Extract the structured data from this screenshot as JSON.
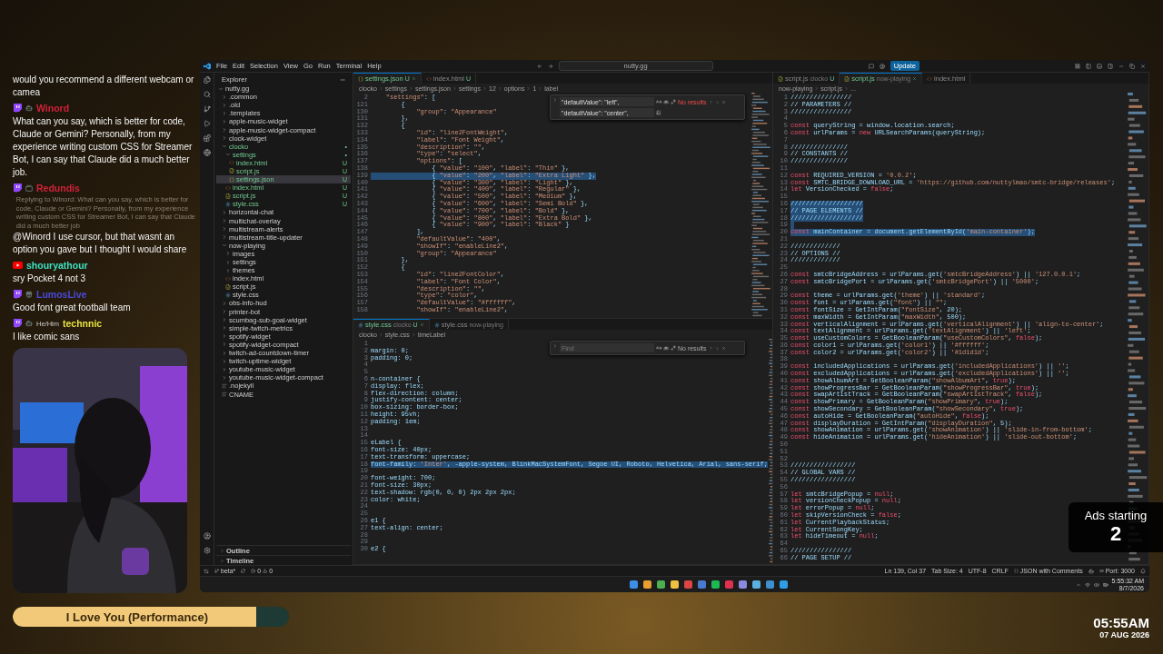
{
  "chat": {
    "messages": [
      {
        "kind": "continued",
        "text": "would you recommend a different webcam or camea"
      },
      {
        "kind": "twitch",
        "user": "Winord",
        "color": "#d0223a",
        "text": "What can you say, which is better for code, Claude or Gemini? Personally, from my experience writing custom CSS for Streamer Bot, I can say that Claude did a much better job."
      },
      {
        "kind": "twitch",
        "user": "Redundis",
        "color": "#d0223a",
        "reply": "Replying to Winord: What can you say, which is better for code, Claude or Gemini? Personally, from my experience writing custom CSS for Streamer Bot, I can say that Claude did a much better job",
        "text": "@Winord I use cursor, but that wasnt an option you gave but I thought I would share"
      },
      {
        "kind": "youtube",
        "user": "shouryathour",
        "color": "#3ee0c0",
        "text": "sry Pocket 4 not 3"
      },
      {
        "kind": "twitch",
        "user": "LumosLive",
        "color": "#4a4ad8",
        "text": "Good font great football team"
      },
      {
        "kind": "twitch",
        "user": "technnic",
        "color": "#e8e040",
        "pronoun": "He/Him",
        "text": "I like comic sans"
      }
    ]
  },
  "now_playing": {
    "title": "I Love You (Performance)",
    "level": 0.88
  },
  "clock": {
    "time": "05:55AM",
    "date": "07 AUG 2026"
  },
  "ads": {
    "label": "Ads starting",
    "count": "2"
  },
  "editor_window": {
    "menu": [
      "File",
      "Edit",
      "Selection",
      "View",
      "Go",
      "Run",
      "Terminal",
      "Help"
    ],
    "search": "nutty.gg",
    "update_button": "Update",
    "explorer": {
      "title": "Explorer",
      "tree": [
        {
          "name": "nutty.gg",
          "kind": "folder",
          "expanded": true,
          "selected": false,
          "children": [
            {
              "name": ".common",
              "kind": "folder",
              "expanded": false,
              "selected": false
            },
            {
              "name": ".old",
              "kind": "folder",
              "expanded": false,
              "selected": false
            },
            {
              "name": ".templates",
              "kind": "folder",
              "expanded": false,
              "selected": false
            },
            {
              "name": "apple-music-widget",
              "kind": "folder",
              "expanded": false,
              "selected": false
            },
            {
              "name": "apple-music-widget-compact",
              "kind": "folder",
              "expanded": false,
              "selected": false
            },
            {
              "name": "clock-widget",
              "kind": "folder",
              "expanded": false,
              "selected": false
            },
            {
              "name": "clocko",
              "kind": "folder",
              "expanded": true,
              "selected": false,
              "status": "•",
              "children": [
                {
                  "name": "settings",
                  "kind": "folder",
                  "expanded": true,
                  "selected": false,
                  "status": "•",
                  "children": [
                    {
                      "name": "index.html",
                      "kind": "html",
                      "selected": false,
                      "status": "U"
                    },
                    {
                      "name": "script.js",
                      "kind": "js",
                      "selected": false,
                      "status": "U"
                    },
                    {
                      "name": "settings.json",
                      "kind": "json",
                      "selected": true,
                      "status": "U"
                    }
                  ]
                },
                {
                  "name": "index.html",
                  "kind": "html",
                  "selected": false,
                  "status": "U"
                },
                {
                  "name": "script.js",
                  "kind": "js",
                  "selected": false,
                  "status": "U"
                },
                {
                  "name": "style.css",
                  "kind": "css",
                  "selected": false,
                  "status": "U"
                }
              ]
            },
            {
              "name": "horizontal-chat",
              "kind": "folder",
              "expanded": false,
              "selected": false
            },
            {
              "name": "multichat-overlay",
              "kind": "folder",
              "expanded": false,
              "selected": false
            },
            {
              "name": "multistream-alerts",
              "kind": "folder",
              "expanded": false,
              "selected": false
            },
            {
              "name": "multistream-title-updater",
              "kind": "folder",
              "expanded": false,
              "selected": false
            },
            {
              "name": "now-playing",
              "kind": "folder",
              "expanded": true,
              "selected": false,
              "children": [
                {
                  "name": "images",
                  "kind": "folder",
                  "expanded": false,
                  "selected": false
                },
                {
                  "name": "settings",
                  "kind": "folder",
                  "expanded": false,
                  "selected": false
                },
                {
                  "name": "themes",
                  "kind": "folder",
                  "expanded": false,
                  "selected": false
                },
                {
                  "name": "index.html",
                  "kind": "html",
                  "selected": false
                },
                {
                  "name": "script.js",
                  "kind": "js",
                  "selected": false
                },
                {
                  "name": "style.css",
                  "kind": "css",
                  "selected": false
                }
              ]
            },
            {
              "name": "obs-info-hud",
              "kind": "folder",
              "expanded": false,
              "selected": false
            },
            {
              "name": "printer-bot",
              "kind": "folder",
              "expanded": false,
              "selected": false
            },
            {
              "name": "scumbag-sub-goal-widget",
              "kind": "folder",
              "expanded": false,
              "selected": false
            },
            {
              "name": "simple-twitch-metrics",
              "kind": "folder",
              "expanded": false,
              "selected": false
            },
            {
              "name": "spotify-widget",
              "kind": "folder",
              "expanded": false,
              "selected": false
            },
            {
              "name": "spotify-widget-compact",
              "kind": "folder",
              "expanded": false,
              "selected": false
            },
            {
              "name": "twitch-ad-countdown-timer",
              "kind": "folder",
              "expanded": false,
              "selected": false
            },
            {
              "name": "twitch-uptime-widget",
              "kind": "folder",
              "expanded": false,
              "selected": false
            },
            {
              "name": "youtube-music-widget",
              "kind": "folder",
              "expanded": false,
              "selected": false
            },
            {
              "name": "youtube-music-widget-compact",
              "kind": "folder",
              "expanded": false,
              "selected": false
            },
            {
              "name": ".nojekyll",
              "kind": "text",
              "selected": false
            },
            {
              "name": "CNAME",
              "kind": "text",
              "selected": false
            }
          ]
        }
      ],
      "sections": [
        {
          "label": "Outline",
          "expanded": false
        },
        {
          "label": "Timeline",
          "expanded": false
        }
      ]
    },
    "groups": [
      {
        "editors": [
          {
            "tabs": [
              {
                "label": "settings.json",
                "kind": "json",
                "badge": "U",
                "selected": true
              },
              {
                "label": "index.html",
                "kind": "html",
                "badge": "U",
                "selected": false
              }
            ],
            "breadcrumbs": [
              "clocko",
              "settings",
              "settings.json",
              "settings",
              "12",
              "options",
              "1",
              "label"
            ],
            "find": {
              "query": "\"defaultValue\": \"left\",",
              "replace": "\"defaultValue\": \"center\",",
              "result": "No results"
            },
            "lines": [
              {
                "n": "2",
                "code": "    \"settings\": [",
                "highlighted": false
              },
              {
                "n": "121",
                "code": "        {",
                "highlighted": false
              },
              {
                "n": "130",
                "code": "            \"group\": \"Appearance\"",
                "highlighted": false
              },
              {
                "n": "131",
                "code": "        },",
                "highlighted": false
              },
              {
                "n": "132",
                "code": "        {",
                "highlighted": false
              },
              {
                "n": "133",
                "code": "            \"id\": \"line2FontWeight\",",
                "highlighted": false
              },
              {
                "n": "134",
                "code": "            \"label\": \"Font Weight\",",
                "highlighted": false
              },
              {
                "n": "135",
                "code": "            \"description\": \"\",",
                "highlighted": false
              },
              {
                "n": "136",
                "code": "            \"type\": \"select\",",
                "highlighted": false
              },
              {
                "n": "137",
                "code": "            \"options\": [",
                "highlighted": false
              },
              {
                "n": "138",
                "code": "                { \"value\": \"100\", \"label\": \"Thin\" },",
                "highlighted": false
              },
              {
                "n": "139",
                "code": "                { \"value\": \"200\", \"label\": \"Extra Light\" },",
                "highlighted": true
              },
              {
                "n": "140",
                "code": "                { \"value\": \"300\", \"label\": \"Light\" },",
                "highlighted": false
              },
              {
                "n": "141",
                "code": "                { \"value\": \"400\", \"label\": \"Regular\" },",
                "highlighted": false
              },
              {
                "n": "142",
                "code": "                { \"value\": \"500\", \"label\": \"Medium\" },",
                "highlighted": false
              },
              {
                "n": "143",
                "code": "                { \"value\": \"600\", \"label\": \"Semi Bold\" },",
                "highlighted": false
              },
              {
                "n": "144",
                "code": "                { \"value\": \"700\", \"label\": \"Bold\" },",
                "highlighted": false
              },
              {
                "n": "145",
                "code": "                { \"value\": \"800\", \"label\": \"Extra Bold\" },",
                "highlighted": false
              },
              {
                "n": "146",
                "code": "                { \"value\": \"900\", \"label\": \"Black\" }",
                "highlighted": false
              },
              {
                "n": "147",
                "code": "            ],",
                "highlighted": false
              },
              {
                "n": "148",
                "code": "            \"defaultValue\": \"400\",",
                "highlighted": false
              },
              {
                "n": "149",
                "code": "            \"showIf\": \"enableLine2\",",
                "highlighted": false
              },
              {
                "n": "150",
                "code": "            \"group\": \"Appearance\"",
                "highlighted": false
              },
              {
                "n": "151",
                "code": "        },",
                "highlighted": false
              },
              {
                "n": "152",
                "code": "        {",
                "highlighted": false
              },
              {
                "n": "153",
                "code": "            \"id\": \"line2FontColor\",",
                "highlighted": false
              },
              {
                "n": "154",
                "code": "            \"label\": \"Font Color\",",
                "highlighted": false
              },
              {
                "n": "155",
                "code": "            \"description\": \"\",",
                "highlighted": false
              },
              {
                "n": "156",
                "code": "            \"type\": \"color\",",
                "highlighted": false
              },
              {
                "n": "157",
                "code": "            \"defaultValue\": \"#ffffff\",",
                "highlighted": false
              },
              {
                "n": "158",
                "code": "            \"showIf\": \"enableLine2\",",
                "highlighted": false
              }
            ]
          },
          {
            "tabs": [
              {
                "label": "style.css",
                "description": "clocko",
                "kind": "css",
                "badge": "U",
                "selected": true
              },
              {
                "label": "style.css",
                "description": "now-playing",
                "kind": "css",
                "selected": false
              }
            ],
            "breadcrumbs": [
              "clocko",
              "style.css",
              "timeLabel"
            ],
            "find": {
              "placeholder": "Find",
              "result": "No results"
            },
            "lines": [
              {
                "n": "1",
                "highlighted": false
              },
              {
                "n": "2",
                "code": "margin: 0;",
                "highlighted": false
              },
              {
                "n": "3",
                "code": "padding: 0;",
                "highlighted": false
              },
              {
                "n": "4",
                "highlighted": false
              },
              {
                "n": "5",
                "highlighted": false
              },
              {
                "n": "6",
                "code": "n-container {",
                "highlighted": false
              },
              {
                "n": "7",
                "code": "display: flex;",
                "highlighted": false
              },
              {
                "n": "8",
                "code": "flex-direction: column;",
                "highlighted": false
              },
              {
                "n": "9",
                "code": "justify-content: center;",
                "highlighted": false
              },
              {
                "n": "10",
                "code": "box-sizing: border-box;",
                "highlighted": false
              },
              {
                "n": "11",
                "code": "height: 95vh;",
                "highlighted": false
              },
              {
                "n": "12",
                "code": "padding: 1em;",
                "highlighted": false
              },
              {
                "n": "13",
                "highlighted": false
              },
              {
                "n": "14",
                "highlighted": false
              },
              {
                "n": "15",
                "code": "eLabel {",
                "highlighted": false
              },
              {
                "n": "16",
                "code": "font-size: 40px;",
                "highlighted": false
              },
              {
                "n": "17",
                "code": "text-transform: uppercase;",
                "highlighted": false
              },
              {
                "n": "18",
                "code": "font-family: 'Inter', -apple-system, BlinkMacSystemFont, Segoe UI, Roboto, Helvetica, Arial, sans-serif;",
                "highlighted": true
              },
              {
                "n": "19",
                "highlighted": false
              },
              {
                "n": "20",
                "code": "font-weight: 700;",
                "highlighted": false
              },
              {
                "n": "21",
                "code": "font-size: 30px;",
                "highlighted": false
              },
              {
                "n": "22",
                "code": "text-shadow: rgb(0, 0, 0) 2px 2px 2px;",
                "highlighted": false
              },
              {
                "n": "23",
                "code": "color: white;",
                "highlighted": false
              },
              {
                "n": "24",
                "highlighted": false
              },
              {
                "n": "25",
                "highlighted": false
              },
              {
                "n": "26",
                "code": "e1 {",
                "highlighted": false
              },
              {
                "n": "27",
                "code": "text-align: center;",
                "highlighted": false
              },
              {
                "n": "28",
                "highlighted": false
              },
              {
                "n": "29",
                "highlighted": false
              },
              {
                "n": "30",
                "code": "e2 {",
                "highlighted": false
              }
            ]
          }
        ]
      },
      {
        "editors": [
          {
            "tabs": [
              {
                "label": "script.js",
                "description": "clocko",
                "kind": "js",
                "badge": "U",
                "selected": false
              },
              {
                "label": "script.js",
                "description": "now-playing",
                "kind": "js",
                "selected": true
              },
              {
                "label": "index.html",
                "kind": "html",
                "selected": false
              }
            ],
            "breadcrumbs": [
              "now-playing",
              "script.js",
              "..."
            ],
            "lines": [
              {
                "n": "1",
                "code": "////////////////",
                "highlighted": false
              },
              {
                "n": "2",
                "code": "// PARAMETERS //",
                "highlighted": false
              },
              {
                "n": "3",
                "code": "////////////////",
                "highlighted": false
              },
              {
                "n": "4",
                "highlighted": false
              },
              {
                "n": "5",
                "code": "const queryString = window.location.search;",
                "highlighted": false
              },
              {
                "n": "6",
                "code": "const urlParams = new URLSearchParams(queryString);",
                "highlighted": false
              },
              {
                "n": "7",
                "highlighted": false
              },
              {
                "n": "8",
                "code": "///////////////",
                "highlighted": false
              },
              {
                "n": "9",
                "code": "// CONSTANTS //",
                "highlighted": false
              },
              {
                "n": "10",
                "code": "///////////////",
                "highlighted": false
              },
              {
                "n": "11",
                "highlighted": false
              },
              {
                "n": "12",
                "code": "const REQUIRED_VERSION = '0.0.2';",
                "highlighted": false
              },
              {
                "n": "13",
                "code": "const SMTC_BRIDGE_DOWNLOAD_URL = 'https://github.com/nuttylmao/smtc-bridge/releases';",
                "highlighted": false
              },
              {
                "n": "14",
                "code": "let VersionChecked = false;",
                "highlighted": false
              },
              {
                "n": "15",
                "highlighted": false
              },
              {
                "n": "16",
                "code": "///////////////////",
                "highlighted": true
              },
              {
                "n": "17",
                "code": "// PAGE ELEMENTS //",
                "highlighted": true
              },
              {
                "n": "18",
                "code": "///////////////////",
                "highlighted": true
              },
              {
                "n": "19",
                "highlighted": true
              },
              {
                "n": "20",
                "code": "const mainContainer = document.getElementById('main-container');",
                "highlighted": true
              },
              {
                "n": "21",
                "highlighted": false
              },
              {
                "n": "22",
                "code": "/////////////",
                "highlighted": false
              },
              {
                "n": "23",
                "code": "// OPTIONS //",
                "highlighted": false
              },
              {
                "n": "24",
                "code": "/////////////",
                "highlighted": false
              },
              {
                "n": "25",
                "highlighted": false
              },
              {
                "n": "26",
                "code": "const smtcBridgeAddress = urlParams.get('smtcBridgeAddress') || '127.0.0.1';",
                "highlighted": false
              },
              {
                "n": "27",
                "code": "const smtcBridgePort = urlParams.get('smtcBridgePort') || '5000';",
                "highlighted": false
              },
              {
                "n": "28",
                "highlighted": false
              },
              {
                "n": "29",
                "code": "const theme = urlParams.get('theme') || 'standard';",
                "highlighted": false
              },
              {
                "n": "30",
                "code": "const font = urlParams.get(\"font\") || \"\";",
                "highlighted": false
              },
              {
                "n": "31",
                "code": "const fontSize = GetIntParam(\"fontSize\", 20);",
                "highlighted": false
              },
              {
                "n": "32",
                "code": "const maxWidth = GetIntParam(\"maxWidth\", 500);",
                "highlighted": false
              },
              {
                "n": "33",
                "code": "const verticalAlignment = urlParams.get('verticalAlignment') || 'align-to-center';",
                "highlighted": false
              },
              {
                "n": "34",
                "code": "const textAlignment = urlParams.get('textAlignment') || 'left';",
                "highlighted": false
              },
              {
                "n": "35",
                "code": "const useCustomColors = GetBooleanParam(\"useCustomColors\", false);",
                "highlighted": false
              },
              {
                "n": "36",
                "code": "const color1 = urlParams.get('color1') || '#ffffff';",
                "highlighted": false
              },
              {
                "n": "37",
                "code": "const color2 = urlParams.get('color2') || '#1d1d1d';",
                "highlighted": false
              },
              {
                "n": "38",
                "highlighted": false
              },
              {
                "n": "39",
                "code": "const includedApplications = urlParams.get('includedApplications') || '';",
                "highlighted": false
              },
              {
                "n": "40",
                "code": "const excludedApplications = urlParams.get('excludedApplications') || '';",
                "highlighted": false
              },
              {
                "n": "41",
                "code": "const showAlbumArt = GetBooleanParam(\"showAlbumArt\", true);",
                "highlighted": false
              },
              {
                "n": "42",
                "code": "const showProgressBar = GetBooleanParam(\"showProgressBar\", true);",
                "highlighted": false
              },
              {
                "n": "43",
                "code": "const swapArtistTrack = GetBooleanParam(\"swapArtistTrack\", false);",
                "highlighted": false
              },
              {
                "n": "44",
                "code": "const showPrimary = GetBooleanParam(\"showPrimary\", true);",
                "highlighted": false
              },
              {
                "n": "45",
                "code": "const showSecondary = GetBooleanParam(\"showSecondary\", true);",
                "highlighted": false
              },
              {
                "n": "46",
                "code": "const autoHide = GetBooleanParam(\"autoHide\", false);",
                "highlighted": false
              },
              {
                "n": "47",
                "code": "const displayDuration = GetIntParam(\"displayDuration\", 5);",
                "highlighted": false
              },
              {
                "n": "48",
                "code": "const showAnimation = urlParams.get('showAnimation') || 'slide-in-from-bottom';",
                "highlighted": false
              },
              {
                "n": "49",
                "code": "const hideAnimation = urlParams.get('hideAnimation') || 'slide-out-bottom';",
                "highlighted": false
              },
              {
                "n": "50",
                "highlighted": false
              },
              {
                "n": "51",
                "highlighted": false
              },
              {
                "n": "52",
                "highlighted": false
              },
              {
                "n": "53",
                "code": "/////////////////",
                "highlighted": false
              },
              {
                "n": "54",
                "code": "// GLOBAL VARS //",
                "highlighted": false
              },
              {
                "n": "55",
                "code": "/////////////////",
                "highlighted": false
              },
              {
                "n": "56",
                "highlighted": false
              },
              {
                "n": "57",
                "code": "let smtcBridgePopup = null;",
                "highlighted": false
              },
              {
                "n": "58",
                "code": "let versionCheckPopup = null;",
                "highlighted": false
              },
              {
                "n": "59",
                "code": "let errorPopup = null;",
                "highlighted": false
              },
              {
                "n": "60",
                "code": "let skipVersionCheck = false;",
                "highlighted": false
              },
              {
                "n": "61",
                "code": "let CurrentPlaybackStatus;",
                "highlighted": false
              },
              {
                "n": "62",
                "code": "let CurrentSongKey;",
                "highlighted": false
              },
              {
                "n": "63",
                "code": "let hideTimeout = null;",
                "highlighted": false
              },
              {
                "n": "64",
                "highlighted": false
              },
              {
                "n": "65",
                "code": "////////////////",
                "highlighted": false
              },
              {
                "n": "66",
                "code": "// PAGE SETUP //",
                "highlighted": false
              }
            ]
          }
        ]
      }
    ],
    "status_bar": {
      "branch": "beta*",
      "errors": "0",
      "warnings": "0",
      "right": [
        {
          "kind": "text",
          "label": "Ln 139, Col 37"
        },
        {
          "kind": "text",
          "label": "Tab Size: 4"
        },
        {
          "kind": "text",
          "label": "UTF-8"
        },
        {
          "kind": "text",
          "label": "CRLF"
        },
        {
          "kind": "language",
          "label": "JSON with Comments"
        },
        {
          "kind": "copilot"
        },
        {
          "kind": "port",
          "label": "Port: 3000"
        },
        {
          "kind": "bell"
        }
      ]
    },
    "taskbar": {
      "time": "5:55:32 AM",
      "date": "8/7/2026"
    }
  }
}
